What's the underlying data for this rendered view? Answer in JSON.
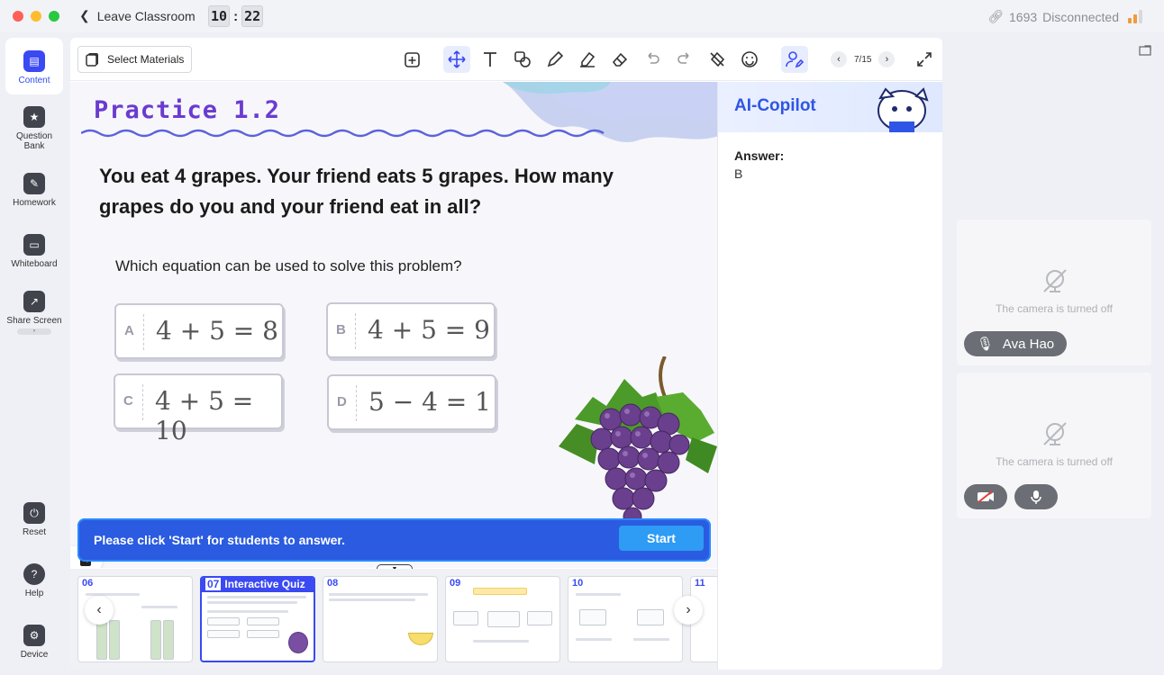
{
  "titlebar": {
    "leave_label": "Leave Classroom",
    "timer_min": "10",
    "timer_sec": "22",
    "class_id": "1693",
    "connection": "Disconnected"
  },
  "sidebar": {
    "items": [
      {
        "label": "Content",
        "icon": "content-icon"
      },
      {
        "label": "Question Bank",
        "icon": "question-bank-icon"
      },
      {
        "label": "Homework",
        "icon": "homework-icon"
      },
      {
        "label": "Whiteboard",
        "icon": "whiteboard-icon"
      },
      {
        "label": "Share Screen",
        "icon": "share-screen-icon"
      },
      {
        "label": "Reset",
        "icon": "reset-icon"
      },
      {
        "label": "Help",
        "icon": "help-icon"
      },
      {
        "label": "Device",
        "icon": "device-icon"
      }
    ]
  },
  "toolbar": {
    "select_materials": "Select Materials",
    "page": "7/15"
  },
  "slide": {
    "title": "Practice 1.2",
    "question": "You eat 4 grapes. Your friend eats 5 grapes. How many grapes do you and your friend eat in all?",
    "sub_question": "Which equation can be used to solve this problem?",
    "options": [
      {
        "letter": "A",
        "equation": "4 + 5 = 8"
      },
      {
        "letter": "B",
        "equation": "4 + 5 = 9"
      },
      {
        "letter": "C",
        "equation": "4 + 5 = 10"
      },
      {
        "letter": "D",
        "equation": "5 − 4 = 1"
      }
    ]
  },
  "prompt": {
    "text": "Please click 'Start' for students to answer.",
    "start_label": "Start"
  },
  "thumbnails": [
    {
      "num": "06"
    },
    {
      "num": "07",
      "title": "Interactive Quiz"
    },
    {
      "num": "08"
    },
    {
      "num": "09"
    },
    {
      "num": "10"
    },
    {
      "num": "11"
    }
  ],
  "copilot": {
    "title": "AI-Copilot",
    "answer_label": "Answer:",
    "answer_value": "B"
  },
  "cameras": [
    {
      "status": "The camera is turned off",
      "name": "Ava Hao"
    },
    {
      "status": "The camera is turned off"
    }
  ],
  "colors": {
    "accent": "#3a49f2",
    "prompt_bg": "#2a5be0",
    "start_btn": "#2e9bf5",
    "title_purple": "#6b3bd0"
  }
}
